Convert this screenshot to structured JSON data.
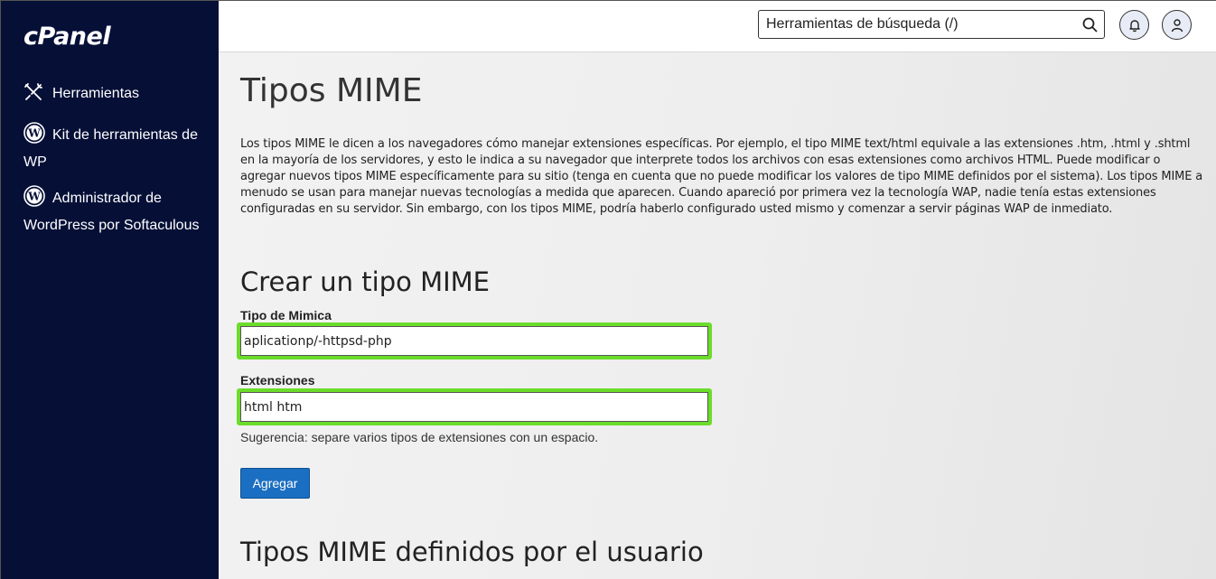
{
  "sidebar": {
    "logo": "cPanel",
    "items": [
      {
        "label": "Herramientas",
        "icon": "tools-icon"
      },
      {
        "label": "Kit de herramientas de WP",
        "icon": "wordpress-icon"
      },
      {
        "label": "Administrador de WordPress por Softaculous",
        "icon": "wordpress-icon"
      }
    ]
  },
  "header": {
    "search_placeholder": "Herramientas de búsqueda (/)",
    "icons": [
      "search-icon",
      "bell-icon",
      "user-icon"
    ]
  },
  "main": {
    "title": "Tipos MIME",
    "description": "Los tipos MIME le dicen a los navegadores cómo manejar extensiones específicas. Por ejemplo, el tipo MIME text/html equivale a las extensiones .htm, .html y .shtml en la mayoría de los servidores, y esto le indica a su navegador que interprete todos los archivos con esas extensiones como archivos HTML. Puede modificar o agregar nuevos tipos MIME específicamente para su sitio (tenga en cuenta que no puede modificar los valores de tipo MIME definidos por el sistema). Los tipos MIME a menudo se usan para manejar nuevas tecnologías a medida que aparecen. Cuando apareció por primera vez la tecnología WAP, nadie tenía estas extensiones configuradas en su servidor. Sin embargo, con los tipos MIME, podría haberlo configurado usted mismo y comenzar a servir páginas WAP de inmediato.",
    "create_section": {
      "title": "Crear un tipo MIME",
      "mime_label": "Tipo de Mimica",
      "mime_value": "aplicationp/-httpsd-php",
      "ext_label": "Extensiones",
      "ext_value": "html htm",
      "hint": "Sugerencia: separe varios tipos de extensiones con un espacio.",
      "add_button": "Agregar"
    },
    "user_section": {
      "title": "Tipos MIME definidos por el usuario"
    }
  },
  "colors": {
    "sidebar_bg": "#061037",
    "highlight": "#6bdc2a",
    "button": "#1b6fc2"
  }
}
